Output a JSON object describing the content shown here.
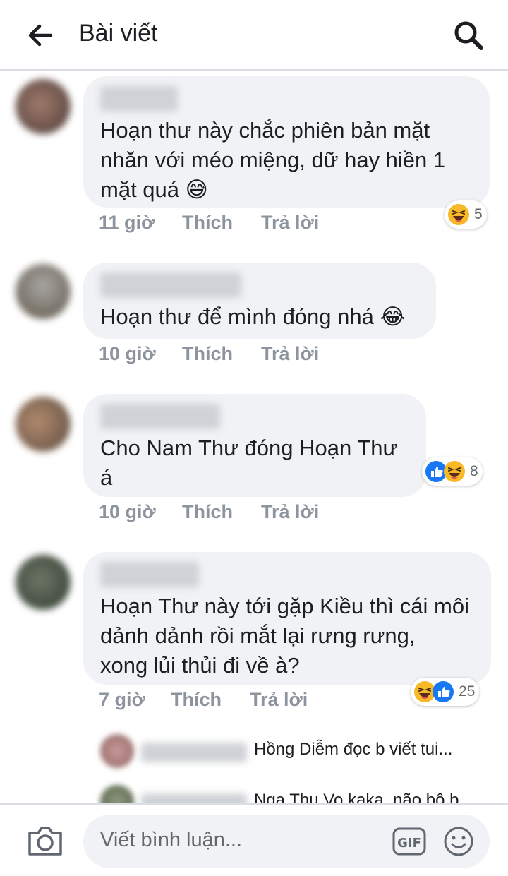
{
  "header": {
    "title": "Bài viết",
    "back_icon": "back-arrow-icon",
    "search_icon": "search-icon"
  },
  "comments": [
    {
      "text": "Hoạn thư này chắc phiên bản mặt\nnhăn với méo miệng, dữ hay hiền 1\nmặt quá 😅",
      "time": "11 giờ",
      "like": "Thích",
      "reply": "Trả lời",
      "reactions": [
        "haha"
      ],
      "reaction_count": "5"
    },
    {
      "text": "Hoạn thư để mình đóng nhá 😂",
      "time": "10 giờ",
      "like": "Thích",
      "reply": "Trả lời",
      "reactions": [],
      "reaction_count": ""
    },
    {
      "text": "Cho Nam Thư đóng Hoạn Thư\ná",
      "time": "10 giờ",
      "like": "Thích",
      "reply": "Trả lời",
      "reactions": [
        "like",
        "haha"
      ],
      "reaction_count": "8"
    },
    {
      "text": "Hoạn Thư này tới gặp Kiều thì cái môi\ndảnh dảnh rồi mắt lại rưng rưng,\nxong lủi thủi đi về à?",
      "time": "7 giờ",
      "like": "Thích",
      "reply": "Trả lời",
      "reactions": [
        "haha",
        "like"
      ],
      "reaction_count": "25"
    }
  ],
  "replies": [
    {
      "text": "Hồng Diễm đọc b viết tui..."
    },
    {
      "text": "Nga Thu Vo kaka, não bộ b"
    }
  ],
  "composer": {
    "placeholder": "Viết bình luận...",
    "camera_icon": "camera-icon",
    "gif_icon": "gif-icon",
    "emoji_icon": "smile-icon"
  },
  "colors": {
    "bubble": "#f0f2f5",
    "meta": "#8d949e",
    "like_blue": "#1877f2",
    "haha_yellow": "#f7b928"
  }
}
